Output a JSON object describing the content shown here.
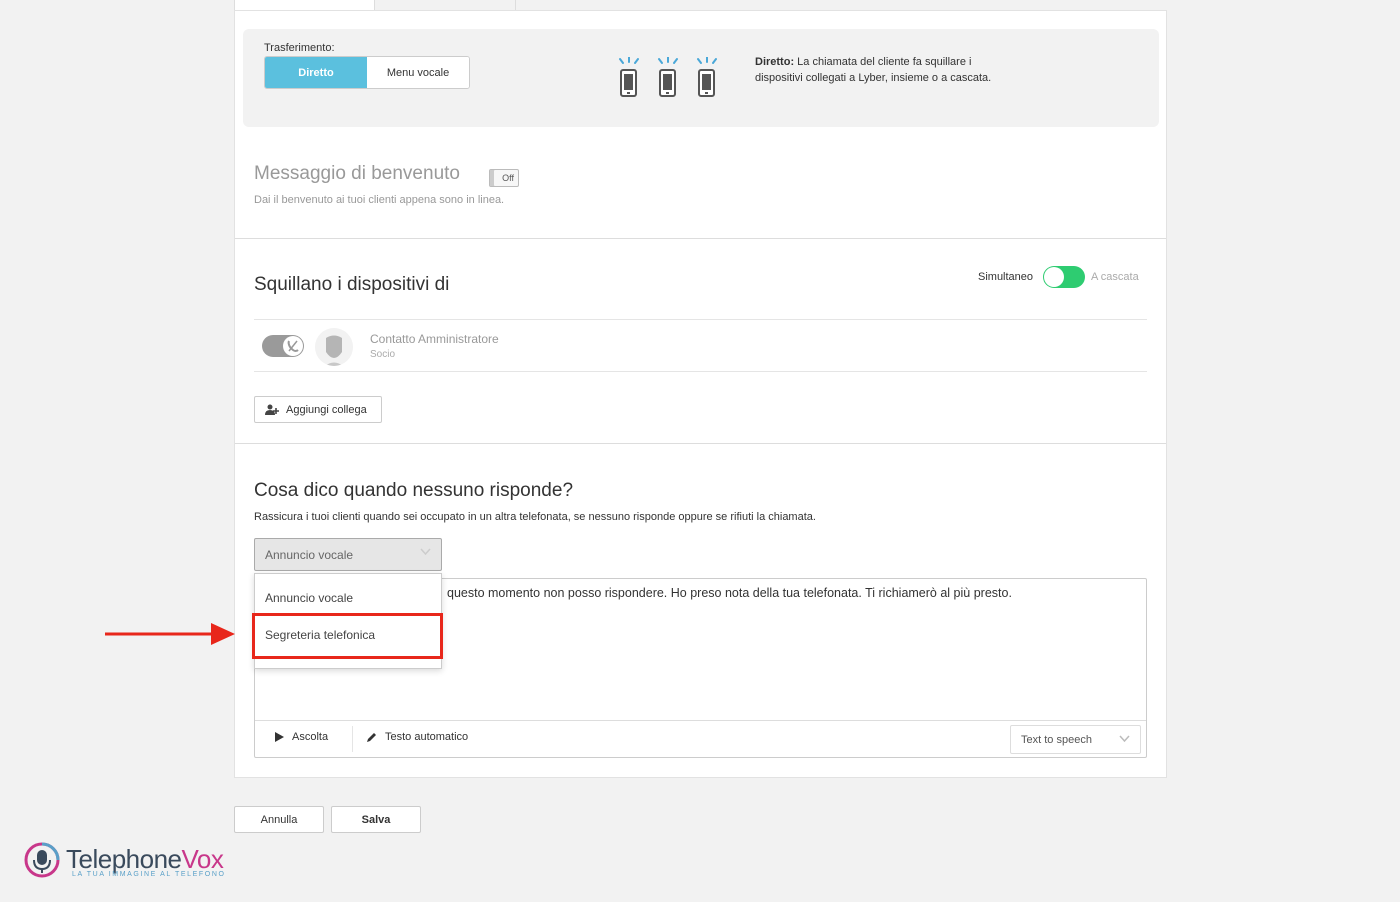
{
  "transfer": {
    "label": "Trasferimento:",
    "options": [
      "Diretto",
      "Menu vocale"
    ],
    "selected": "Diretto",
    "desc_bold": "Diretto:",
    "desc_text": " La chiamata del cliente fa squillare i dispositivi collegati a Lyber, insieme o a cascata."
  },
  "welcome": {
    "title": "Messaggio di benvenuto",
    "toggle_label": "Off",
    "subtitle": "Dai il benvenuto ai tuoi clienti appena sono in linea."
  },
  "ring": {
    "title": "Squillano i dispositivi di",
    "mode_left": "Simultaneo",
    "mode_right": "A cascata",
    "contact_name": "Contatto Amministratore",
    "contact_role": "Socio",
    "add_button": "Aggiungi collega"
  },
  "no_answer": {
    "title": "Cosa dico quando nessuno risponde?",
    "subtitle": "Rassicura i tuoi clienti quando sei occupato in un altra telefonata, se nessuno risponde oppure se rifiuti la chiamata.",
    "select_value": "Annuncio vocale",
    "dropdown_options": [
      "Annuncio vocale",
      "Segreteria telefonica"
    ],
    "message": "questo momento non posso rispondere. Ho preso nota della tua telefonata. Ti richiamerò al più presto.",
    "listen": "Ascolta",
    "auto_text": "Testo automatico",
    "tts": "Text to speech"
  },
  "actions": {
    "cancel": "Annulla",
    "save": "Salva"
  },
  "logo": {
    "name_part1": "Telephone",
    "name_part2": "Vox",
    "tagline": "LA TUA IMMAGINE AL TELEFONO"
  },
  "colors": {
    "accent": "#5bc0de",
    "toggle_on": "#2ecc71",
    "highlight": "#e8271b"
  }
}
